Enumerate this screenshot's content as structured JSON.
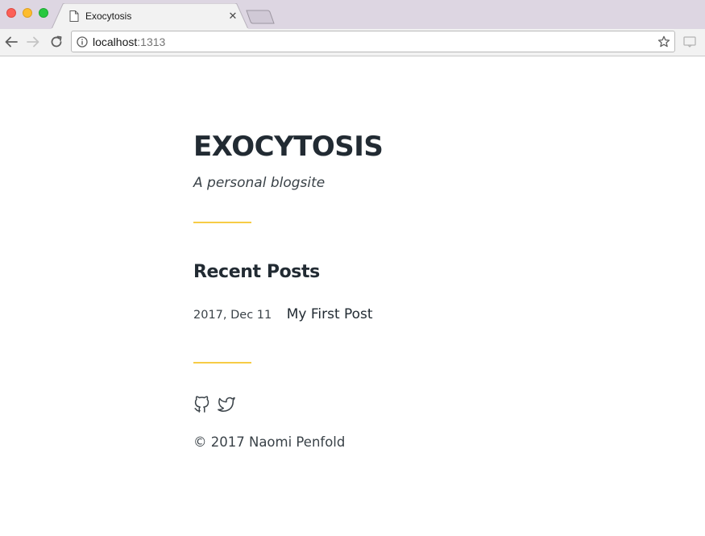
{
  "browser": {
    "tab": {
      "title": "Exocytosis",
      "favicon_icon": "document-icon",
      "close_glyph": "✕"
    },
    "address_bar": {
      "host": "localhost",
      "port": ":1313"
    },
    "icons": {
      "back": "arrow-left-icon",
      "forward": "arrow-right-icon",
      "reload": "reload-icon",
      "info": "info-circle-icon",
      "bookmark": "star-icon",
      "cast": "cast-icon"
    }
  },
  "site": {
    "title": "EXOCYTOSIS",
    "tagline": "A personal blogsite",
    "accent_color": "#f7cc46",
    "text_color": "#222b33"
  },
  "recent_posts": {
    "heading": "Recent Posts",
    "posts": [
      {
        "date": "2017, Dec 11",
        "title": "My First Post"
      }
    ]
  },
  "footer": {
    "social": [
      {
        "name": "github",
        "icon": "github-icon"
      },
      {
        "name": "twitter",
        "icon": "twitter-icon"
      }
    ],
    "copyright": "© 2017 Naomi Penfold"
  }
}
